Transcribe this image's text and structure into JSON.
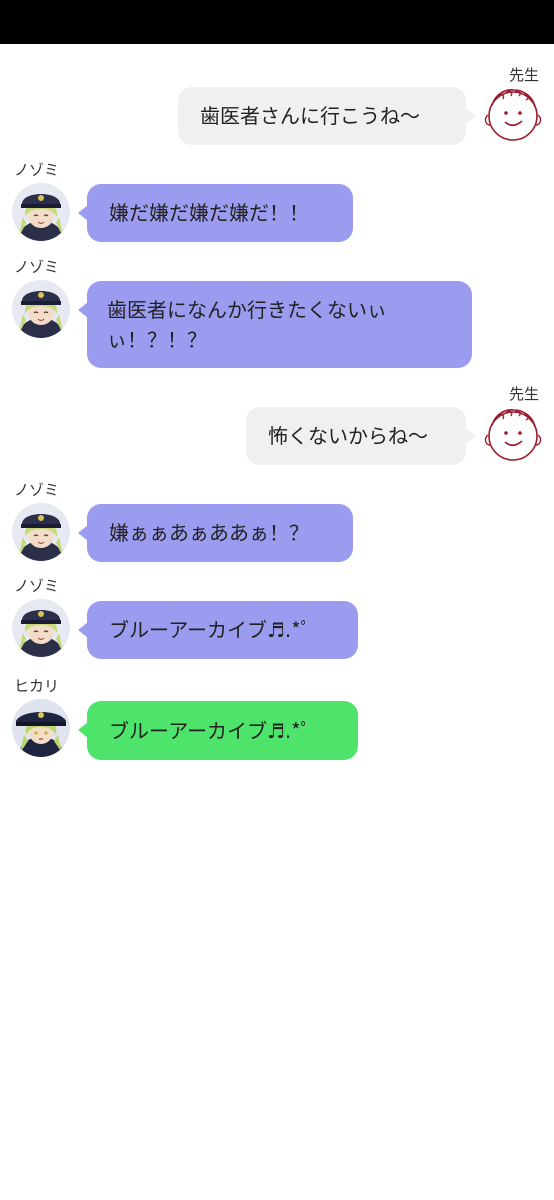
{
  "colors": {
    "sent_bubble": "#f0f0f0",
    "nozomi_bubble": "#9b9cf0",
    "hikari_bubble": "#4ee36a",
    "status_bar": "#000000"
  },
  "messages": [
    {
      "sender": "先生",
      "side": "right",
      "text": "歯医者さんに行こうね〜",
      "avatar_icon": "sensei-doodle-avatar-icon"
    },
    {
      "sender": "ノゾミ",
      "side": "left",
      "text": "嫌だ嫌だ嫌だ嫌だ！！",
      "avatar_icon": "nozomi-avatar-icon"
    },
    {
      "sender": "ノゾミ",
      "side": "left",
      "text": "歯医者になんか行きたくないぃぃ！？！？",
      "avatar_icon": "nozomi-avatar-icon"
    },
    {
      "sender": "先生",
      "side": "right",
      "text": "怖くないからね〜",
      "avatar_icon": "sensei-doodle-avatar-icon"
    },
    {
      "sender": "ノゾミ",
      "side": "left",
      "text": "嫌ぁぁあぁああぁ！？",
      "avatar_icon": "nozomi-avatar-icon"
    },
    {
      "sender": "ノゾミ",
      "side": "left",
      "text": "ブルーアーカイブ♬.*ﾟ",
      "avatar_icon": "nozomi-avatar-icon"
    },
    {
      "sender": "ヒカリ",
      "side": "left",
      "text": "ブルーアーカイブ♬.*ﾟ",
      "avatar_icon": "hikari-avatar-icon"
    }
  ]
}
